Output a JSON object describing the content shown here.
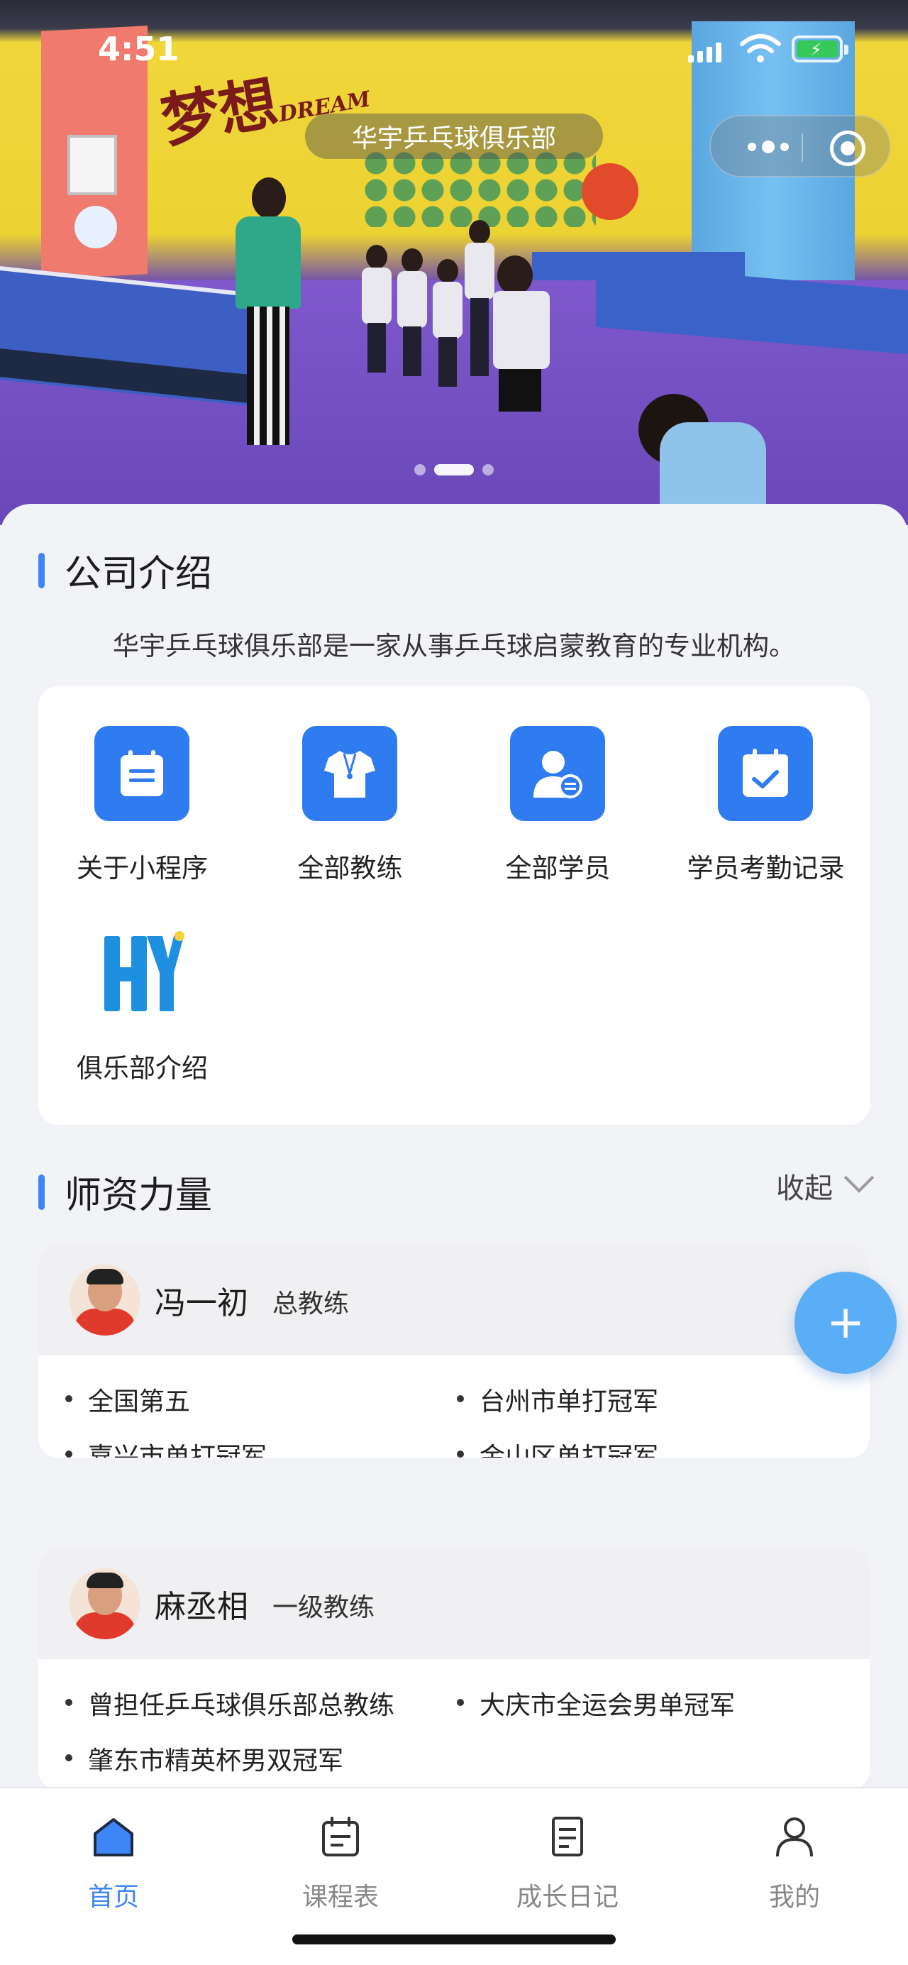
{
  "status_bar": {
    "time": "4:51"
  },
  "header": {
    "title": "华宇乒乓球俱乐部"
  },
  "banner": {
    "slide_count": 3,
    "active_slide": 2
  },
  "company": {
    "section_title": "公司介绍",
    "intro": "华宇乒乓球俱乐部是一家从事乒乓球启蒙教育的专业机构。",
    "menu": [
      {
        "label": "关于小程序",
        "icon": "calendar-list-icon"
      },
      {
        "label": "全部教练",
        "icon": "jersey-icon"
      },
      {
        "label": "全部学员",
        "icon": "student-icon"
      },
      {
        "label": "学员考勤记录",
        "icon": "calendar-check-icon"
      },
      {
        "label": "俱乐部介绍",
        "icon": "club-logo-icon"
      }
    ]
  },
  "coaches": {
    "section_title": "师资力量",
    "collapse_label": "收起",
    "list": [
      {
        "name": "冯一初",
        "role": "总教练",
        "honors": [
          "全国第五",
          "台州市单打冠军",
          "嘉兴市单打冠军",
          "金山区单打冠军"
        ]
      },
      {
        "name": "麻丞相",
        "role": "一级教练",
        "honors": [
          "曾担任乒乓球俱乐部总教练",
          "大庆市全运会男单冠军",
          "肇东市精英杯男双冠军"
        ]
      }
    ]
  },
  "fab": {
    "label": "+"
  },
  "tabbar": {
    "items": [
      {
        "label": "首页",
        "icon": "home-icon",
        "active": true
      },
      {
        "label": "课程表",
        "icon": "schedule-icon",
        "active": false
      },
      {
        "label": "成长日记",
        "icon": "diary-icon",
        "active": false
      },
      {
        "label": "我的",
        "icon": "profile-icon",
        "active": false
      }
    ]
  },
  "colors": {
    "accent": "#3e86f5",
    "icon_bg": "#2f7cf1",
    "fab": "#5aaef5",
    "page_bg": "#f2f3f7"
  }
}
